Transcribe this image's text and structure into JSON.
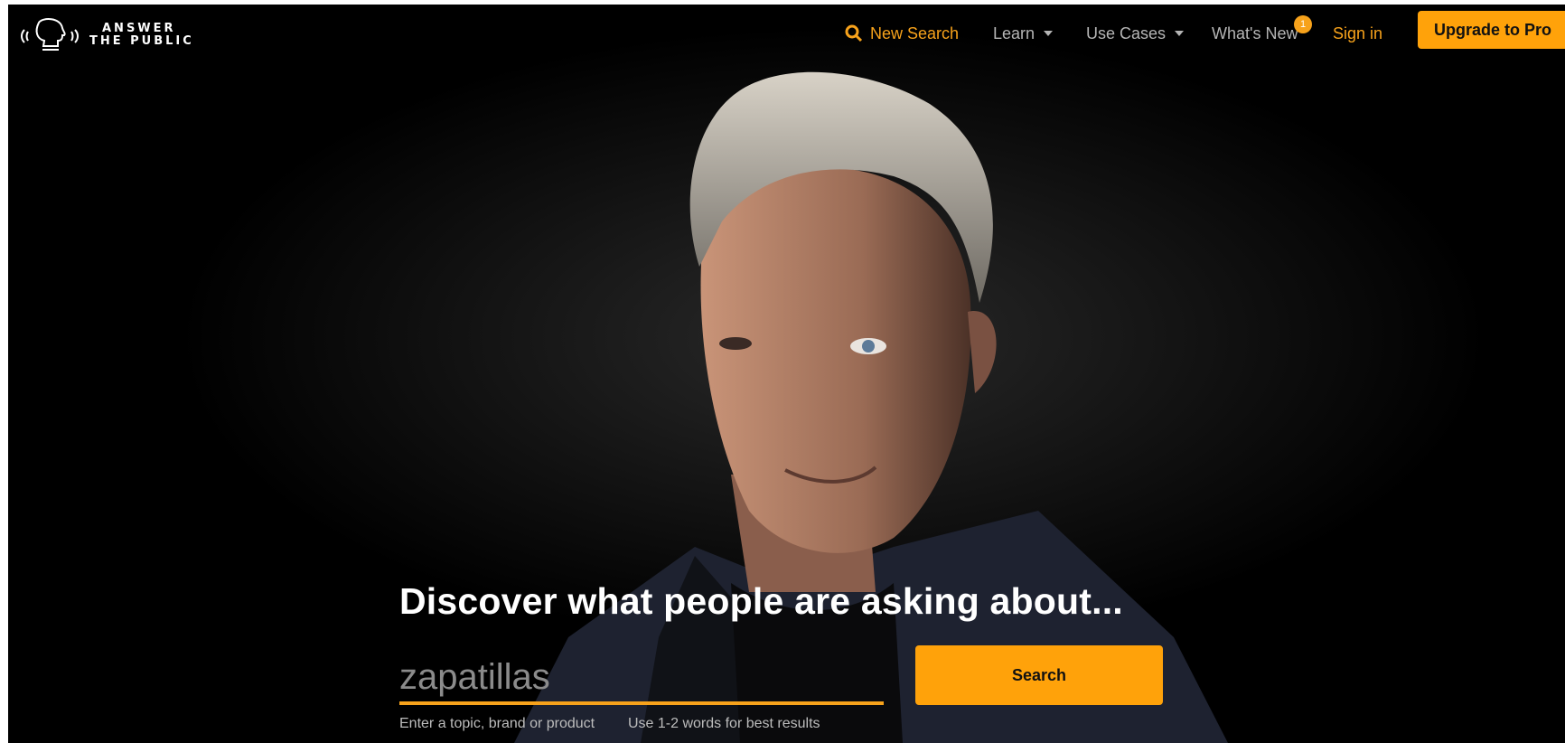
{
  "brand": {
    "logo_line1": "ANSWER",
    "logo_line2": "THE PUBLIC"
  },
  "nav": {
    "new_search": "New Search",
    "learn": "Learn",
    "use_cases": "Use Cases",
    "whats_new": "What's New",
    "whats_new_badge": "1",
    "sign_in": "Sign in",
    "upgrade": "Upgrade to Pro"
  },
  "hero": {
    "headline": "Discover what people are asking about...",
    "search_placeholder": "zapatillas",
    "search_button": "Search",
    "hint_left": "Enter a topic, brand or product",
    "hint_right": "Use 1-2 words for best results"
  },
  "colors": {
    "accent": "#ffa20a",
    "background": "#000000",
    "nav_text": "#b5b5b5"
  },
  "icons": [
    "logo-icon",
    "search-icon",
    "chevron-down-icon"
  ]
}
